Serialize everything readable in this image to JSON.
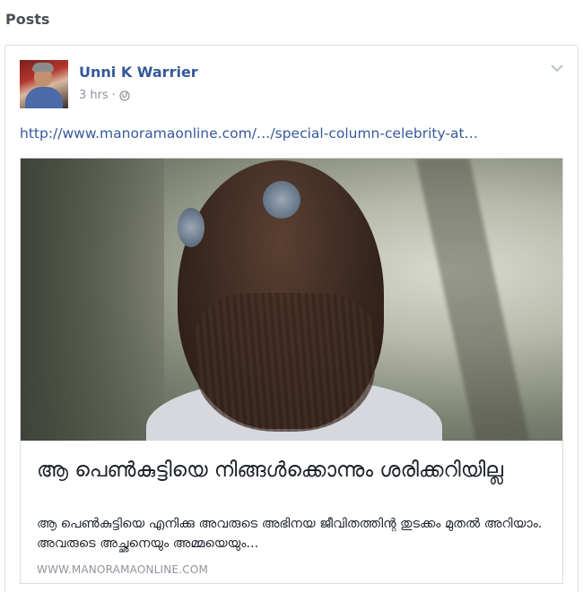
{
  "section": {
    "title": "Posts"
  },
  "post": {
    "author": "Unni K Warrier",
    "time": "3 hrs",
    "separator": "·",
    "privacy_icon": "globe-icon",
    "menu_icon": "chevron-down-icon",
    "link_text": "http://www.manoramaonline.com/…/special-column-celebrity-at…",
    "preview": {
      "image": "girl-with-flower-hairclips-photo",
      "title": "ആ പെൺകുട്ടിയെ നിങ്ങൾക്കൊന്നും ശരിക്കറിയില്ല",
      "description": "ആ പെൺകുട്ടിയെ എനിക്കു അവരുടെ അഭിനയ ജീവിതത്തിന്റ തുടക്കം മുതൽ അറിയാം. അവരുടെ അച്ഛനെയും അമ്മയെയും...",
      "domain": "WWW.MANORAMAONLINE.COM"
    }
  },
  "colors": {
    "link": "#365899",
    "meta": "#90949c",
    "border": "#dddfe2"
  }
}
